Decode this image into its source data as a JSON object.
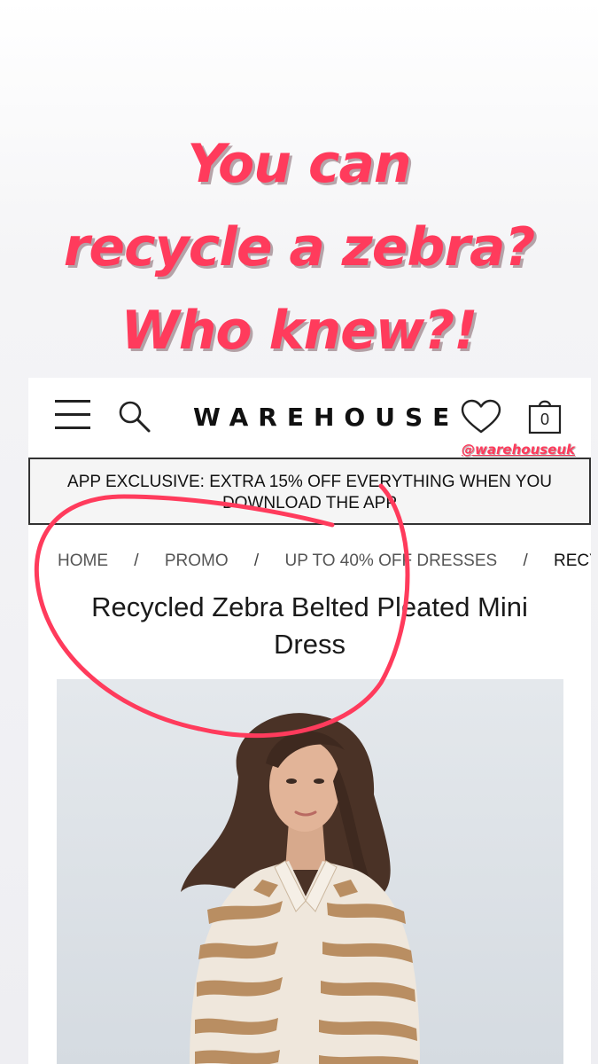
{
  "caption": {
    "line1": "You can",
    "line2": "recycle a zebra?",
    "line3": "Who knew?!"
  },
  "header": {
    "logo": "WAREHOUSE",
    "bag_count": "0",
    "handle": "@warehouseuk",
    "icons": [
      "menu-icon",
      "search-icon",
      "heart-icon",
      "shopping-bag-icon"
    ]
  },
  "banner": {
    "line1": "APP EXCLUSIVE: EXTRA 15% OFF EVERYTHING WHEN YOU",
    "line2": "DOWNLOAD THE APP"
  },
  "breadcrumb": {
    "items": [
      "HOME",
      "PROMO",
      "UP TO 40% OFF DRESSES",
      "RECYCL"
    ],
    "separator": "/"
  },
  "product": {
    "title_line1": "Recycled Zebra Belted Pleated Mini",
    "title_line2": "Dress"
  },
  "colors": {
    "accent": "#ff3b5c",
    "text": "#111111",
    "banner_bg": "#f5f5f5"
  }
}
